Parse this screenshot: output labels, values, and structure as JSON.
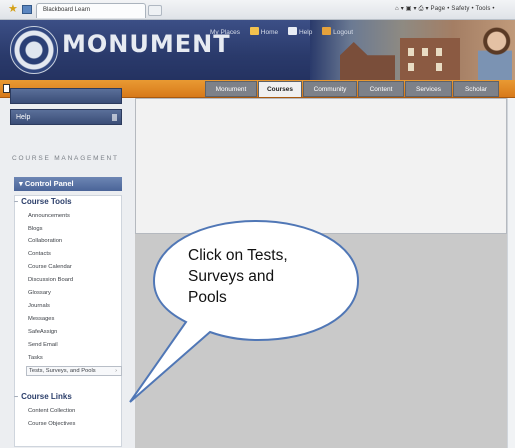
{
  "browser": {
    "tab_title": "Blackboard Learn",
    "toolbar_text": "Page •  Safety •  Tools •"
  },
  "banner": {
    "brand": "MONUMENT",
    "top_links": [
      "My Places",
      "Home",
      "Help",
      "Logout"
    ]
  },
  "nav": {
    "tabs": [
      "Monument",
      "Courses",
      "Community",
      "Content",
      "Services",
      "Scholar"
    ],
    "active": "Courses"
  },
  "sidebar": {
    "help_button": "Help",
    "course_management_label": "COURSE MANAGEMENT",
    "control_panel": "Control Panel",
    "course_tools_header": "Course Tools",
    "course_tools": [
      "Announcements",
      "Blogs",
      "Collaboration",
      "Contacts",
      "Course Calendar",
      "Discussion Board",
      "Glossary",
      "Journals",
      "Messages",
      "SafeAssign",
      "Send Email",
      "Tasks",
      "Tests, Surveys, and Pools"
    ],
    "course_links_header": "Course Links",
    "course_links": [
      "Content Collection",
      "Course Objectives"
    ]
  },
  "callout": {
    "line1": "Click on Tests,",
    "line2": "Surveys and",
    "line3": "Pools"
  },
  "colors": {
    "banner_navy": "#2a3a6b",
    "nav_orange": "#e0882a",
    "sidebar_blue": "#4a6498"
  }
}
